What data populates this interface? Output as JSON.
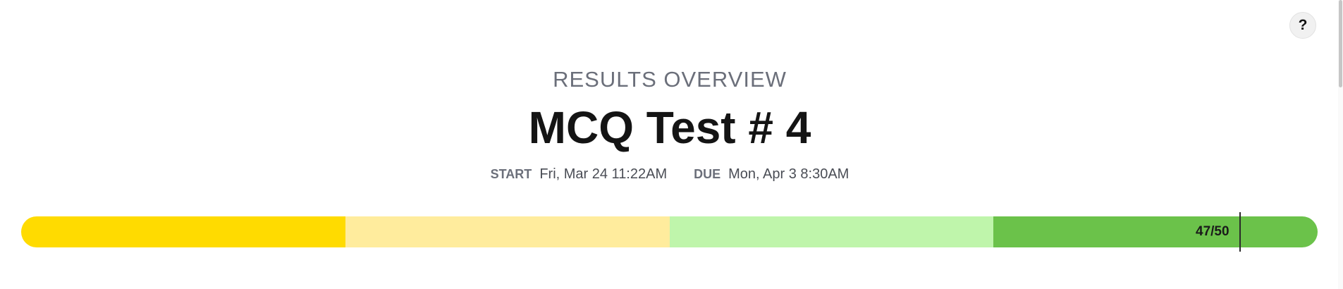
{
  "header": {
    "overview_label": "RESULTS OVERVIEW",
    "title": "MCQ Test # 4"
  },
  "dates": {
    "start_key": "START",
    "start_value": "Fri, Mar 24 11:22AM",
    "due_key": "DUE",
    "due_value": "Mon, Apr 3 8:30AM"
  },
  "help": {
    "label": "?",
    "icon": "question-mark-icon"
  },
  "score": {
    "label": "47/50",
    "earned": 47,
    "total": 50,
    "fraction": 0.94
  },
  "progress_segments": [
    {
      "color": "#FFDB00"
    },
    {
      "color": "#FFEC9D"
    },
    {
      "color": "#BFF5AB"
    },
    {
      "color": "#6BC24A"
    }
  ]
}
